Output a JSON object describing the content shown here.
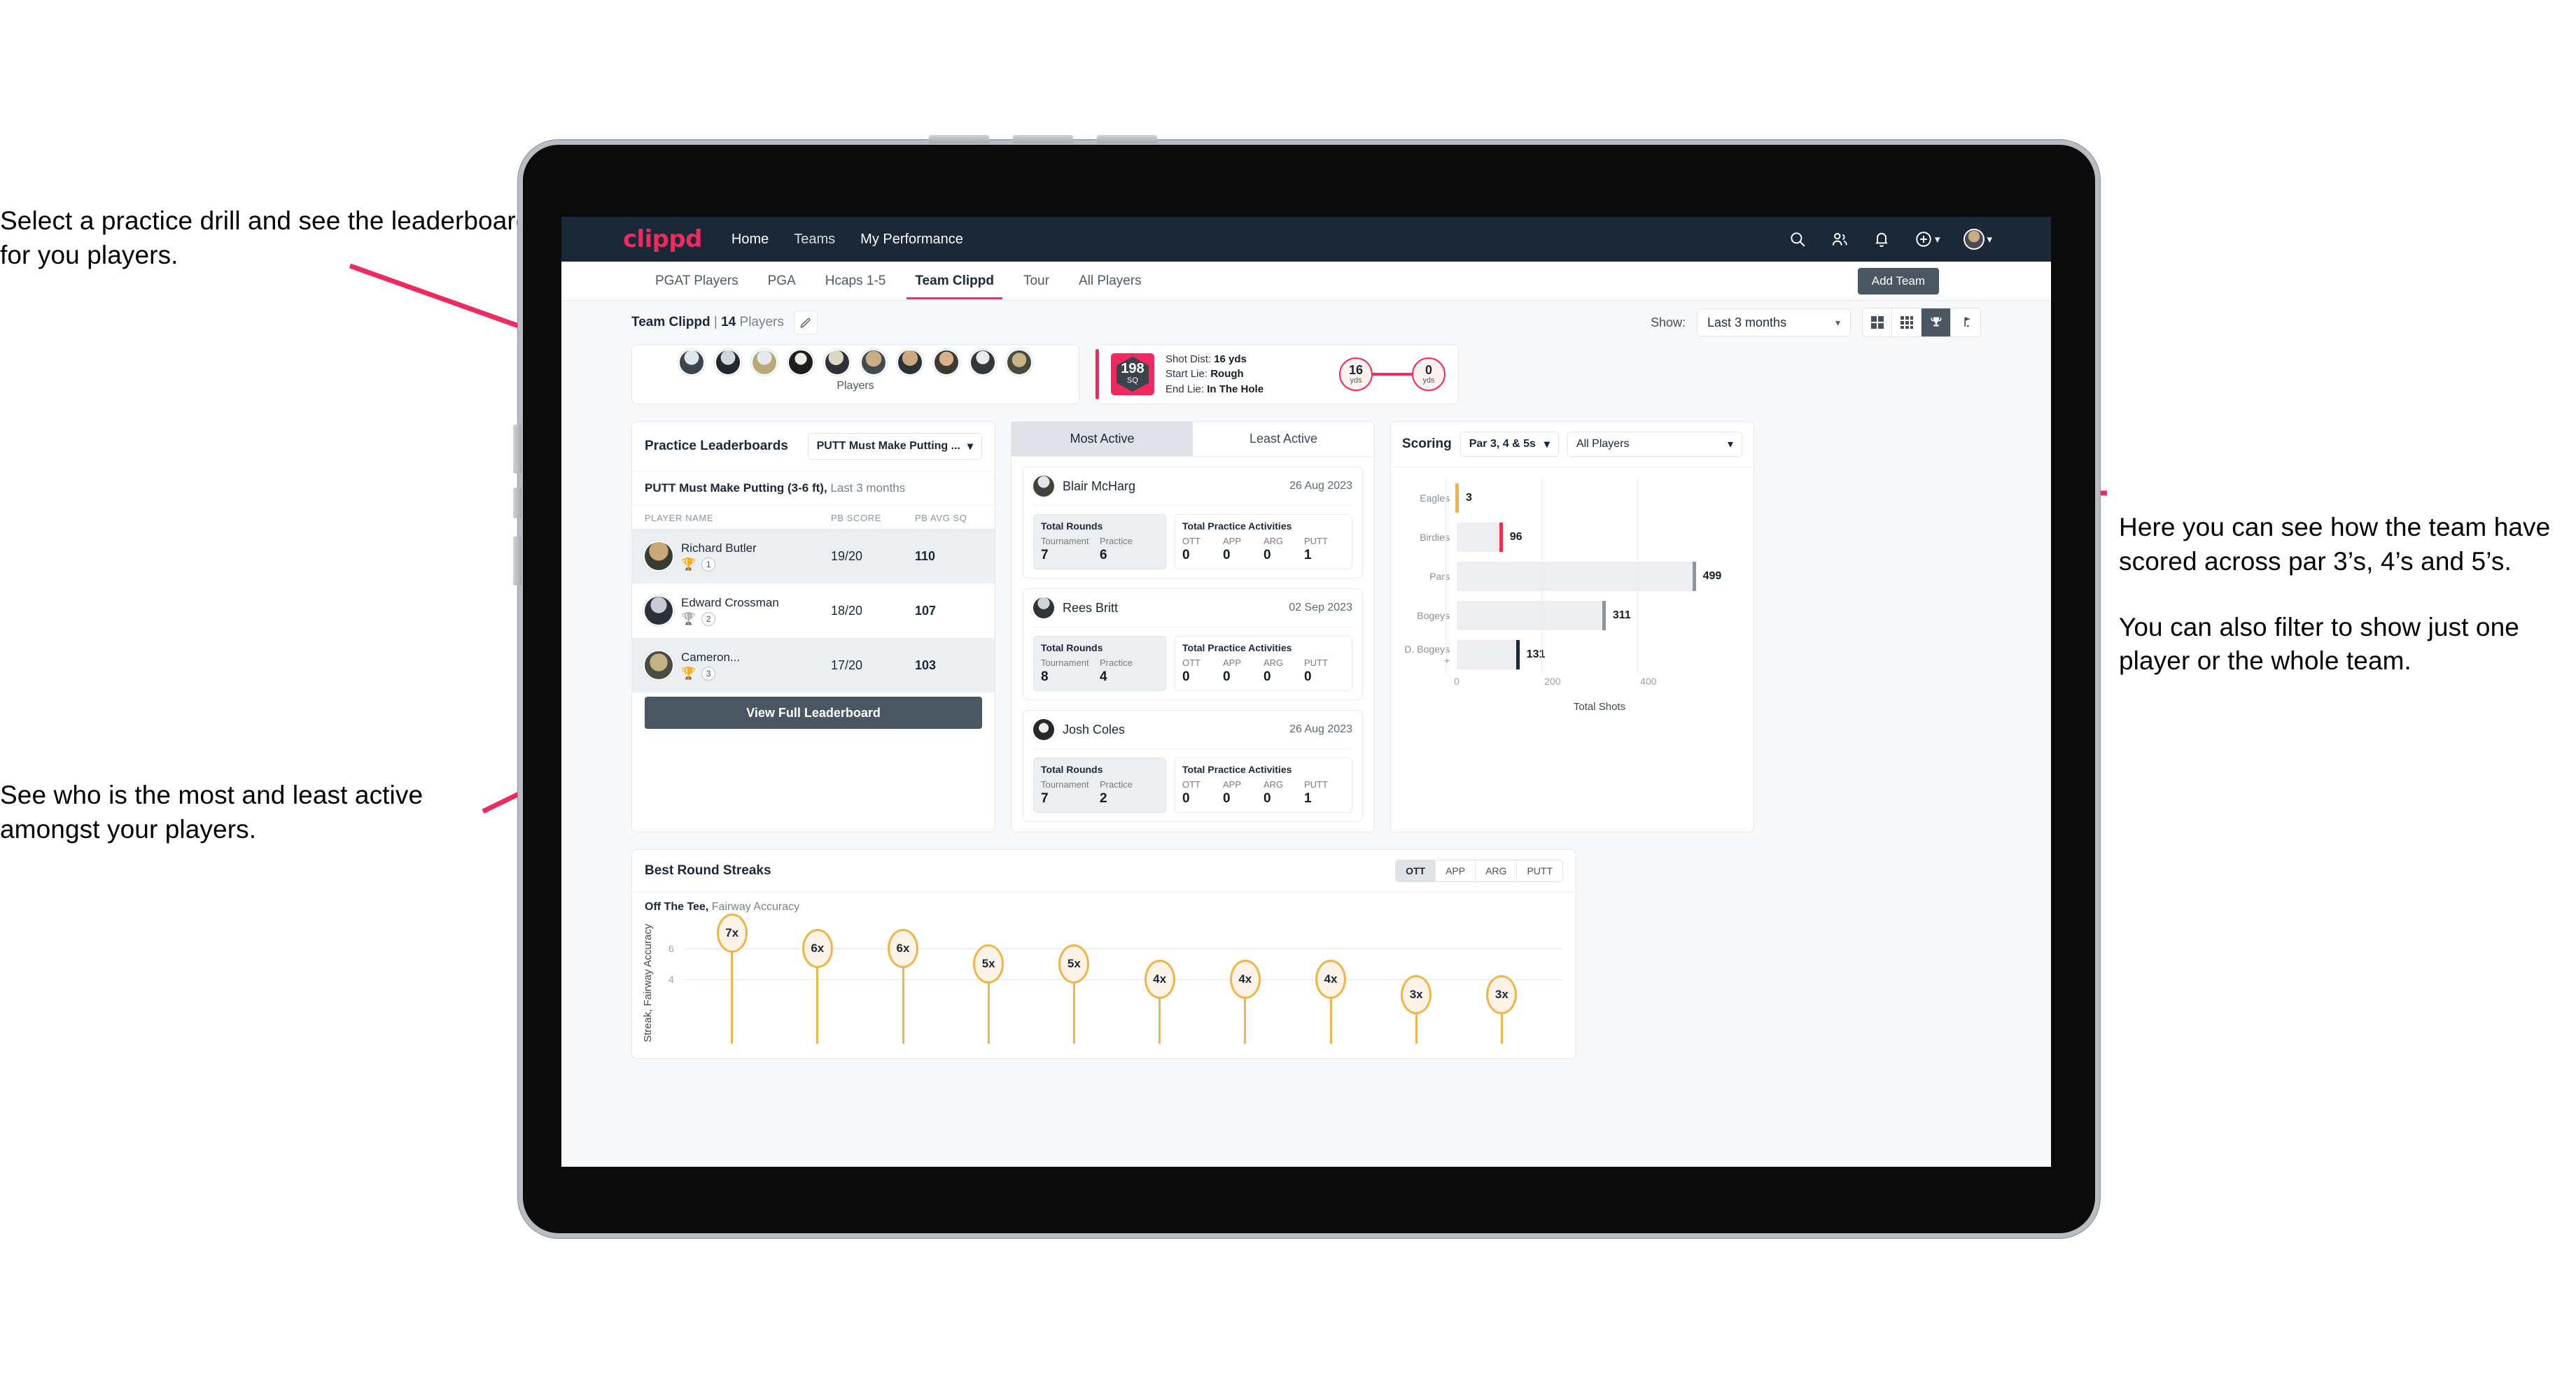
{
  "annotations": {
    "top_left": "Select a practice drill and see the leaderboard for you players.",
    "bottom_left": "See who is the most and least active amongst your players.",
    "right_p1": "Here you can see how the team have scored across par 3’s, 4’s and 5’s.",
    "right_p2": "You can also filter to show just one player or the whole team."
  },
  "navbar": {
    "brand": "clippd",
    "links": [
      {
        "label": "Home",
        "active": true
      },
      {
        "label": "Teams",
        "active": false
      },
      {
        "label": "My Performance",
        "active": true
      }
    ],
    "icons": [
      "search-icon",
      "people-icon",
      "bell-icon",
      "plus-circle-icon",
      "avatar"
    ]
  },
  "tabs": [
    {
      "label": "PGAT Players",
      "active": false
    },
    {
      "label": "PGA",
      "active": false
    },
    {
      "label": "Hcaps 1-5",
      "active": false
    },
    {
      "label": "Team Clippd",
      "active": true
    },
    {
      "label": "Tour",
      "active": false
    },
    {
      "label": "All Players",
      "active": false
    }
  ],
  "add_team_button": "Add Team",
  "subbar": {
    "team_label_bold": "Team Clippd",
    "team_sep": " | ",
    "team_count": "14",
    "team_count_suffix": " Players",
    "edit_icon": "pencil-icon",
    "show_label": "Show:",
    "show_value": "Last 3 months",
    "view_toggles": [
      "grid-2x2-icon",
      "grid-3x3-icon",
      "trophy-icon",
      "flag-icon"
    ],
    "active_view": "trophy-icon"
  },
  "players_card": {
    "label": "Players",
    "avatar_count": 10
  },
  "shot_card": {
    "sq_value": "198",
    "sq_unit": "SQ",
    "lines": [
      {
        "key": "Shot Dist:",
        "value": "16 yds"
      },
      {
        "key": "Start Lie:",
        "value": "Rough"
      },
      {
        "key": "End Lie:",
        "value": "In The Hole"
      }
    ],
    "start_dist": "16",
    "start_unit": "yds",
    "end_dist": "0",
    "end_unit": "yds"
  },
  "leaderboard": {
    "title": "Practice Leaderboards",
    "drill_select": "PUTT Must Make Putting ...",
    "subtitle_bold": "PUTT Must Make Putting (3-6 ft),",
    "subtitle_dim": " Last 3 months",
    "columns": [
      "PLAYER NAME",
      "PB SCORE",
      "PB AVG SQ"
    ],
    "rows": [
      {
        "name": "Richard Butler",
        "trophy": "gold",
        "rank": "1",
        "pb_score": "19/20",
        "pb_avg_sq": "110"
      },
      {
        "name": "Edward Crossman",
        "trophy": "silver",
        "rank": "2",
        "pb_score": "18/20",
        "pb_avg_sq": "107"
      },
      {
        "name": "Cameron...",
        "trophy": "bronze",
        "rank": "3",
        "pb_score": "17/20",
        "pb_avg_sq": "103"
      }
    ],
    "view_full_button": "View Full Leaderboard"
  },
  "activity": {
    "tabs": [
      {
        "label": "Most Active",
        "active": true
      },
      {
        "label": "Least Active",
        "active": false
      }
    ],
    "rounds_title": "Total Rounds",
    "practice_title": "Total Practice Activities",
    "rounds_keys": [
      "Tournament",
      "Practice"
    ],
    "practice_keys": [
      "OTT",
      "APP",
      "ARG",
      "PUTT"
    ],
    "items": [
      {
        "name": "Blair McHarg",
        "date": "26 Aug 2023",
        "tournament": "7",
        "practice": "6",
        "ott": "0",
        "app": "0",
        "arg": "0",
        "putt": "1"
      },
      {
        "name": "Rees Britt",
        "date": "02 Sep 2023",
        "tournament": "8",
        "practice": "4",
        "ott": "0",
        "app": "0",
        "arg": "0",
        "putt": "0"
      },
      {
        "name": "Josh Coles",
        "date": "26 Aug 2023",
        "tournament": "7",
        "practice": "2",
        "ott": "0",
        "app": "0",
        "arg": "0",
        "putt": "1"
      }
    ]
  },
  "scoring": {
    "title": "Scoring",
    "par_filter": "Par 3, 4 & 5s",
    "player_filter": "All Players"
  },
  "streaks": {
    "title": "Best Round Streaks",
    "segments": [
      {
        "label": "OTT",
        "active": true
      },
      {
        "label": "APP",
        "active": false
      },
      {
        "label": "ARG",
        "active": false
      },
      {
        "label": "PUTT",
        "active": false
      }
    ],
    "sub_bold": "Off The Tee,",
    "sub_dim": " Fairway Accuracy"
  },
  "colors": {
    "brand_pink": "#ee2a5e",
    "navy": "#1b2838",
    "slate": "#4a5662",
    "amber": "#f0b44a",
    "bar_grey": "#eceef1"
  },
  "chart_data": [
    {
      "type": "bar",
      "orientation": "horizontal",
      "title": "Scoring",
      "categories": [
        "Eagles",
        "Birdies",
        "Pars",
        "Bogeys",
        "D. Bogeys +"
      ],
      "values": [
        3,
        96,
        499,
        311,
        131
      ],
      "cap_colors": [
        "#f0b44a",
        "#e8344e",
        "#8d959e",
        "#8d959e",
        "#1b2838"
      ],
      "xlabel": "Total Shots",
      "ylabel": "",
      "xlim": [
        0,
        520
      ],
      "xticks": [
        0,
        200,
        400
      ],
      "grid": true,
      "legend": "none"
    },
    {
      "type": "bar",
      "orientation": "vertical",
      "title": "Best Round Streaks",
      "subtitle": "Off The Tee, Fairway Accuracy",
      "ylabel": "Streak, Fairway Accuracy",
      "categories": [
        "1",
        "2",
        "3",
        "4",
        "5",
        "6",
        "7",
        "8",
        "9",
        "10"
      ],
      "values": [
        7,
        6,
        6,
        5,
        5,
        4,
        4,
        4,
        3,
        3
      ],
      "point_labels": [
        "7x",
        "6x",
        "6x",
        "5x",
        "5x",
        "4x",
        "4x",
        "4x",
        "3x",
        "3x"
      ],
      "yticks": [
        4,
        6
      ],
      "ylim": [
        0,
        8
      ],
      "grid": true,
      "legend": "none"
    }
  ]
}
